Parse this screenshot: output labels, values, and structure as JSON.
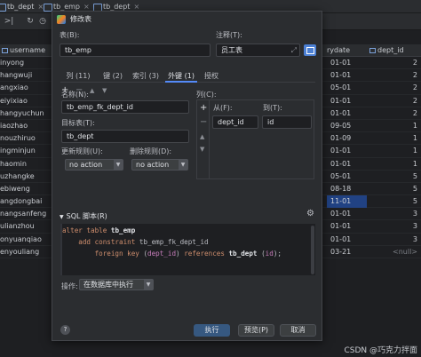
{
  "ide": {
    "tabs": [
      {
        "label": "tb_dept"
      },
      {
        "label": "tb_emp"
      },
      {
        "label": "tb_dept"
      }
    ],
    "toolbar_icons": [
      "run-to-cursor-icon",
      "refresh-icon",
      "history-icon"
    ],
    "grid": {
      "col_username": "username",
      "col_entrydate": "rydate",
      "col_dept_id": "dept_id",
      "rows": [
        {
          "username": "inyong",
          "date": "01-01",
          "dept_id": "2",
          "selected": false
        },
        {
          "username": "hangwuji",
          "date": "01-01",
          "dept_id": "2",
          "selected": false
        },
        {
          "username": "angxiao",
          "date": "05-01",
          "dept_id": "2",
          "selected": false
        },
        {
          "username": "eiyixiao",
          "date": "01-01",
          "dept_id": "2",
          "selected": false
        },
        {
          "username": "hangyuchun",
          "date": "01-01",
          "dept_id": "2",
          "selected": false
        },
        {
          "username": "iaozhao",
          "date": "09-05",
          "dept_id": "1",
          "selected": false
        },
        {
          "username": "nouzhiruo",
          "date": "01-09",
          "dept_id": "1",
          "selected": false
        },
        {
          "username": "ingminjun",
          "date": "01-01",
          "dept_id": "1",
          "selected": false
        },
        {
          "username": "haomin",
          "date": "01-01",
          "dept_id": "1",
          "selected": false
        },
        {
          "username": "uzhangke",
          "date": "05-01",
          "dept_id": "5",
          "selected": false
        },
        {
          "username": "ebiweng",
          "date": "08-18",
          "dept_id": "5",
          "selected": false
        },
        {
          "username": "angdongbai",
          "date": "11-01",
          "dept_id": "5",
          "selected": true
        },
        {
          "username": "nangsanfeng",
          "date": "01-01",
          "dept_id": "3",
          "selected": false
        },
        {
          "username": "ulianzhou",
          "date": "01-01",
          "dept_id": "3",
          "selected": false
        },
        {
          "username": "onyuanqiao",
          "date": "01-01",
          "dept_id": "3",
          "selected": false
        },
        {
          "username": "enyouliang",
          "date": "03-21",
          "dept_id": "<null>",
          "selected": false
        }
      ]
    },
    "watermark": "CSDN @巧克力拌面"
  },
  "dialog": {
    "title": "修改表",
    "table_label": "表(B):",
    "table_value": "tb_emp",
    "comment_label": "注释(T):",
    "comment_value": "员工表",
    "tabs": [
      {
        "label": "列 (11)",
        "active": false
      },
      {
        "label": "键 (2)",
        "active": false
      },
      {
        "label": "索引 (3)",
        "active": false
      },
      {
        "label": "外键 (1)",
        "active": true
      },
      {
        "label": "授权",
        "active": false
      }
    ],
    "fk_name_label": "名称(N):",
    "fk_name_value": "tb_emp_fk_dept_id",
    "target_table_label": "目标表(T):",
    "target_table_value": "tb_dept",
    "on_update_label": "更新规则(U):",
    "on_update_value": "no action",
    "on_delete_label": "删除规则(D):",
    "on_delete_value": "no action",
    "columns_label": "列(C):",
    "from_header": "从(F):",
    "to_header": "到(T):",
    "from_value": "dept_id",
    "to_value": "id",
    "sql_header": "SQL 脚本(R)",
    "sql_lines": [
      {
        "kw1": "alter table ",
        "name": "tb_emp",
        "kw2": "",
        "rest": ""
      },
      {
        "kw1": "    add constraint ",
        "name": "tb_emp_fk_dept_id",
        "kw2": "",
        "rest": ""
      },
      {
        "kw1": "        foreign key ",
        "name": "",
        "kw2": "",
        "rest": ""
      }
    ],
    "sql_fk_column": "dept_id",
    "sql_references": "references",
    "sql_ref_table": "tb_dept",
    "sql_ref_column": "id",
    "action_label": "操作:",
    "action_value": "在数据库中执行",
    "execute_label": "执行",
    "preview_label": "预览(P)",
    "cancel_label": "取消",
    "help_label": "?"
  }
}
